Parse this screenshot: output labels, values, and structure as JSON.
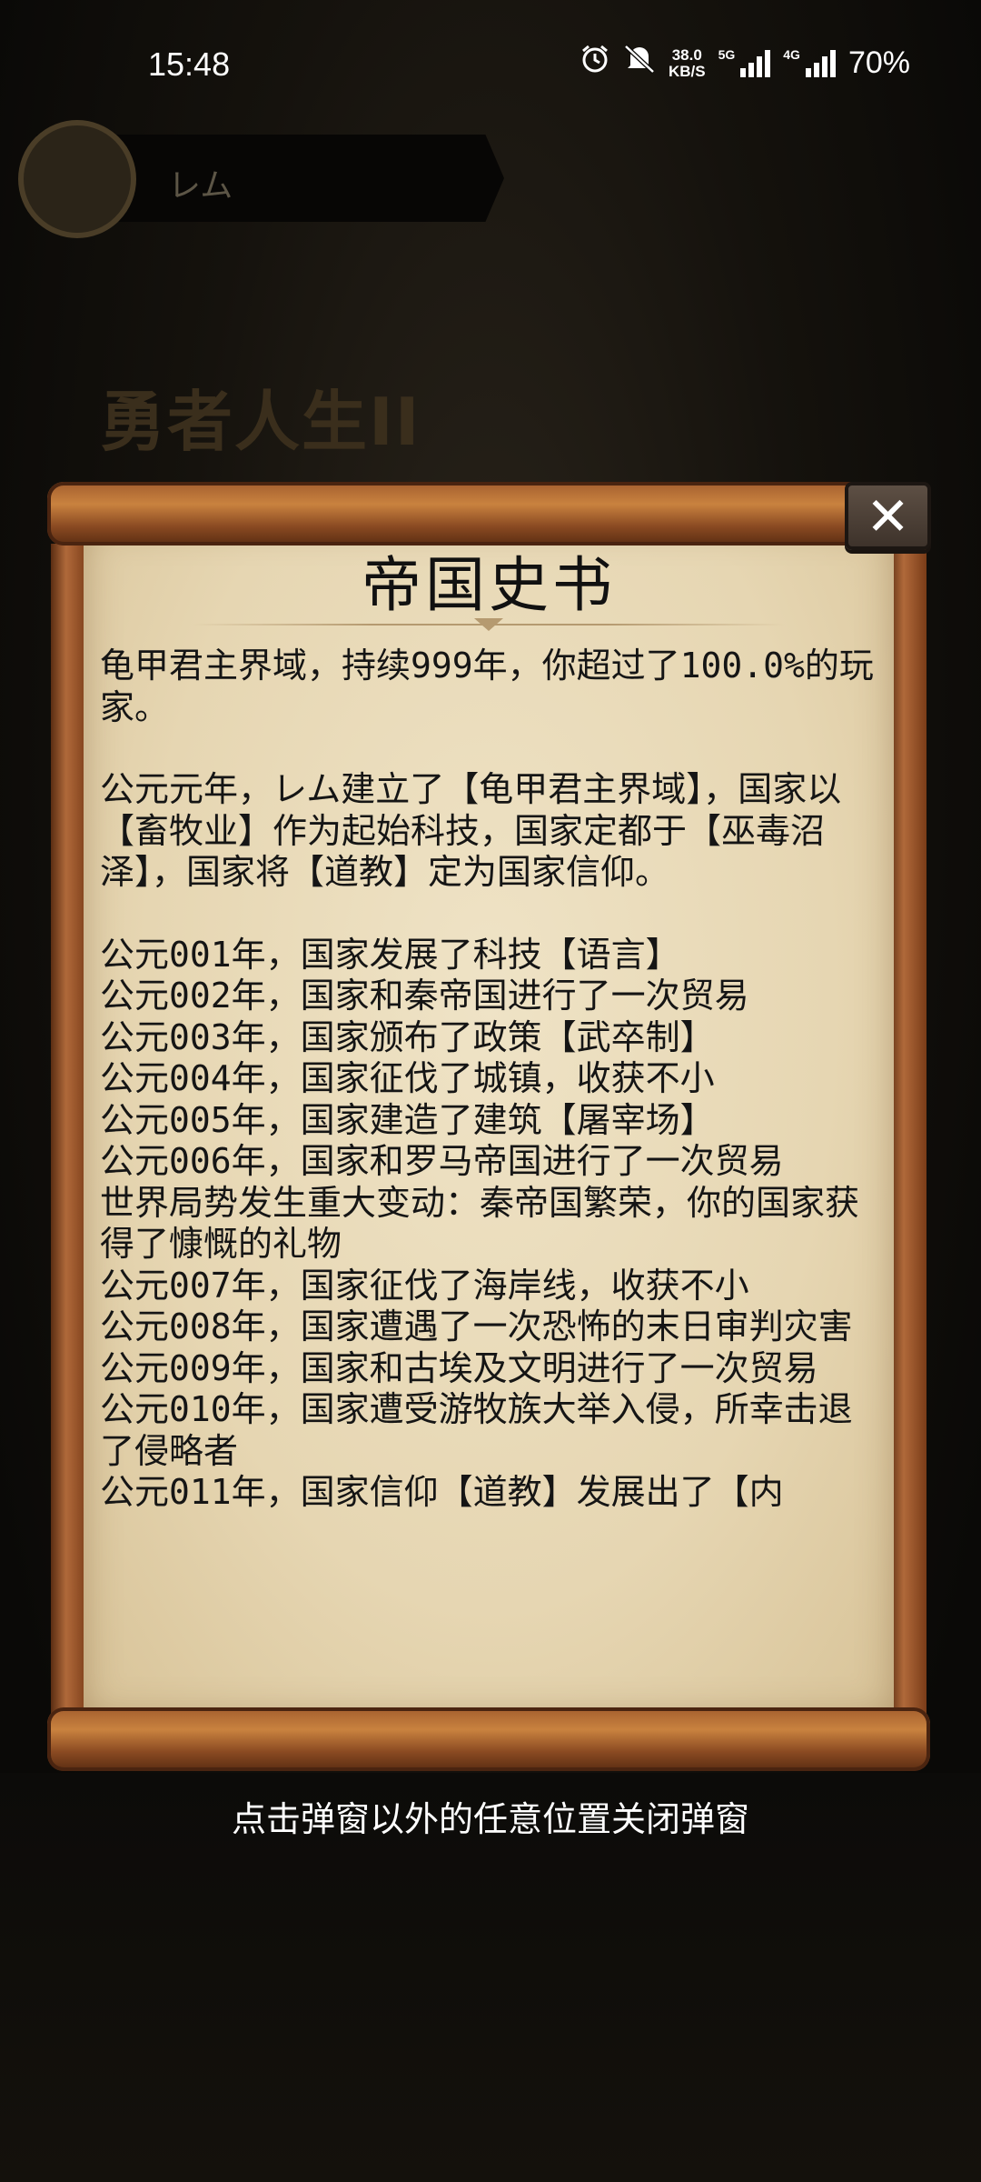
{
  "status_bar": {
    "time": "15:48",
    "speed_top": "38.0",
    "speed_bottom": "KB/S",
    "net_label": "5G",
    "net_label2": "4G",
    "battery": "70%",
    "icons": [
      "alarm-icon",
      "mute-icon",
      "signal-icon",
      "signal-icon"
    ]
  },
  "background": {
    "player_name": "レム",
    "game_title": "勇者人生II"
  },
  "dialog": {
    "title": "帝国史书",
    "close_label": "✕",
    "summary": "龟甲君主界域，持续999年，你超过了100.0%的玩家。",
    "founding": "公元元年，レム建立了【龟甲君主界域】，国家以【畜牧业】作为起始科技，国家定都于【巫毒沼泽】，国家将【道教】定为国家信仰。",
    "events": [
      "公元001年，国家发展了科技【语言】",
      "公元002年，国家和秦帝国进行了一次贸易",
      "公元003年，国家颁布了政策【武卒制】",
      "公元004年，国家征伐了城镇，收获不小",
      "公元005年，国家建造了建筑【屠宰场】",
      "公元006年，国家和罗马帝国进行了一次贸易",
      "世界局势发生重大变动：秦帝国繁荣，你的国家获得了慷慨的礼物",
      "公元007年，国家征伐了海岸线，收获不小",
      "公元008年，国家遭遇了一次恐怖的末日审判灾害",
      "公元009年，国家和古埃及文明进行了一次贸易",
      "公元010年，国家遭受游牧族大举入侵，所幸击退了侵略者",
      "公元011年，国家信仰【道教】发展出了【内"
    ]
  },
  "hint": "点击弹窗以外的任意位置关闭弹窗"
}
